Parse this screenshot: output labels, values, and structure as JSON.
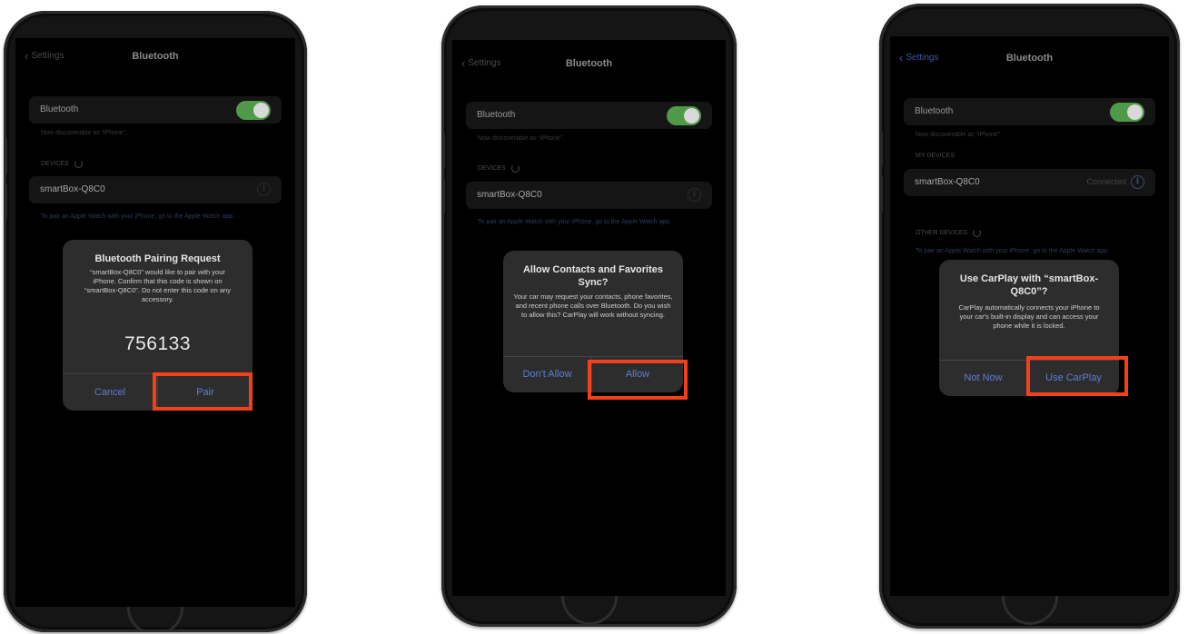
{
  "phone1": {
    "nav": {
      "back_label": "Settings",
      "title": "Bluetooth"
    },
    "bluetooth_row_label": "Bluetooth",
    "toggle_on": true,
    "discoverable_text": "Now discoverable as “iPhone”.",
    "devices_label": "DEVICES",
    "device_name": "smartBox-Q8C0",
    "footnote": "To pair an Apple Watch with your iPhone, go to the Apple Watch app.",
    "alert": {
      "title": "Bluetooth Pairing Request",
      "message": "“smartBox-Q8C0” would like to pair with your iPhone. Confirm that this code is shown on “smartBox-Q8C0”. Do not enter this code on any accessory.",
      "code": "756133",
      "cancel_label": "Cancel",
      "confirm_label": "Pair"
    }
  },
  "phone2": {
    "nav": {
      "back_label": "Settings",
      "title": "Bluetooth"
    },
    "bluetooth_row_label": "Bluetooth",
    "toggle_on": true,
    "discoverable_text": "Now discoverable as “iPhone”.",
    "devices_label": "DEVICES",
    "device_name": "smartBox-Q8C0",
    "footnote": "To pair an Apple Watch with your iPhone, go to the Apple Watch app.",
    "alert": {
      "title": "Allow Contacts and Favorites Sync?",
      "message": "Your car may request your contacts, phone favorites, and recent phone calls over Bluetooth. Do you wish to allow this? CarPlay will work without syncing.",
      "cancel_label": "Don't Allow",
      "confirm_label": "Allow"
    }
  },
  "phone3": {
    "nav": {
      "back_label": "Settings",
      "title": "Bluetooth"
    },
    "bluetooth_row_label": "Bluetooth",
    "toggle_on": true,
    "discoverable_text": "Now discoverable as “iPhone”.",
    "my_devices_label": "MY DEVICES",
    "device_name": "smartBox-Q8C0",
    "device_status": "Connected",
    "other_devices_label": "OTHER DEVICES",
    "footnote": "To pair an Apple Watch with your iPhone, go to the Apple Watch app.",
    "alert": {
      "title": "Use CarPlay with “smartBox-Q8C0”?",
      "message": "CarPlay automatically connects your iPhone to your car's built-in display and can access your phone while it is locked.",
      "cancel_label": "Not Now",
      "confirm_label": "Use CarPlay"
    }
  },
  "colors": {
    "highlight": "#f2401b",
    "alert_button": "#5b7fd3",
    "toggle_on": "#4e9a48",
    "alert_bg": "#2d2d2d"
  }
}
